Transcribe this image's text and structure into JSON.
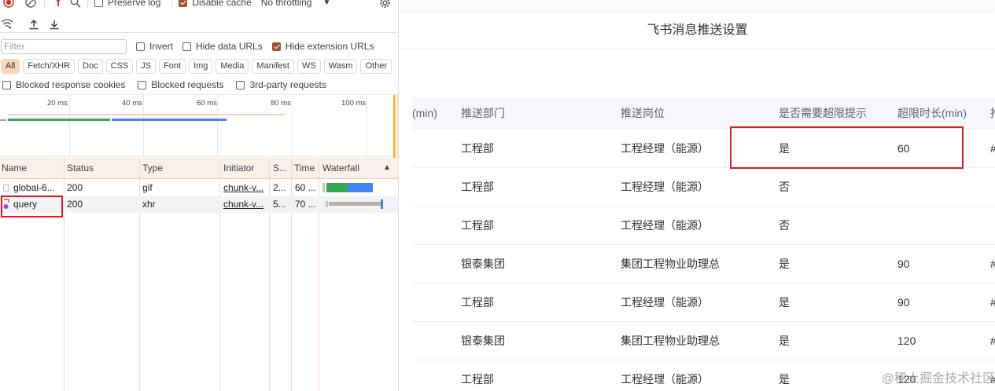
{
  "devtools": {
    "toolbar": {
      "preserve_log": "Preserve log",
      "disable_cache": "Disable cache",
      "throttling": "No throttling"
    },
    "filter": {
      "placeholder": "Filter",
      "invert": "Invert",
      "hide_data_urls": "Hide data URLs",
      "hide_extension_urls": "Hide extension URLs"
    },
    "type_filters": [
      "All",
      "Fetch/XHR",
      "Doc",
      "CSS",
      "JS",
      "Font",
      "Img",
      "Media",
      "Manifest",
      "WS",
      "Wasm",
      "Other"
    ],
    "blocked": {
      "blocked_cookies": "Blocked response cookies",
      "blocked_requests": "Blocked requests",
      "third_party": "3rd-party requests"
    },
    "overview_ticks": [
      "20 ms",
      "40 ms",
      "60 ms",
      "80 ms",
      "100 ms"
    ],
    "columns": [
      "Name",
      "Status",
      "Type",
      "Initiator",
      "S...",
      "Time",
      "Waterfall"
    ],
    "requests": [
      {
        "name": "global-6...",
        "status": "200",
        "type": "gif",
        "initiator": "chunk-v...",
        "size": "2...",
        "time": "60 ..."
      },
      {
        "name": "query",
        "status": "200",
        "type": "xhr",
        "initiator": "chunk-v...",
        "size": "5...",
        "time": "70 ..."
      }
    ]
  },
  "page": {
    "dialog_title": "飞书消息推送设置",
    "partial_header": "(min)",
    "headers": [
      "推送部门",
      "推送岗位",
      "是否需要超限提示",
      "超限时长(min)",
      "推"
    ],
    "rows": [
      {
        "dept": "工程部",
        "post": "工程经理（能源）",
        "alert": "是",
        "duration": "60",
        "extra": "#"
      },
      {
        "dept": "工程部",
        "post": "工程经理（能源）",
        "alert": "否",
        "duration": "",
        "extra": ""
      },
      {
        "dept": "工程部",
        "post": "工程经理（能源）",
        "alert": "否",
        "duration": "",
        "extra": ""
      },
      {
        "dept": "银泰集团",
        "post": "集团工程物业助理总",
        "alert": "是",
        "duration": "90",
        "extra": "#"
      },
      {
        "dept": "工程部",
        "post": "工程经理（能源）",
        "alert": "是",
        "duration": "90",
        "extra": "#"
      },
      {
        "dept": "银泰集团",
        "post": "集团工程物业助理总",
        "alert": "是",
        "duration": "120",
        "extra": "#"
      },
      {
        "dept": "工程部",
        "post": "工程经理（能源）",
        "alert": "是",
        "duration": "120",
        "extra": "#"
      }
    ],
    "watermark": "@稀土掘金技术社区"
  },
  "colors": {
    "accent": "#a0522d",
    "highlight": "#e0191f",
    "wf_green": "#34a853",
    "wf_blue": "#4285f4",
    "wf_gray": "#b9b2aa"
  }
}
